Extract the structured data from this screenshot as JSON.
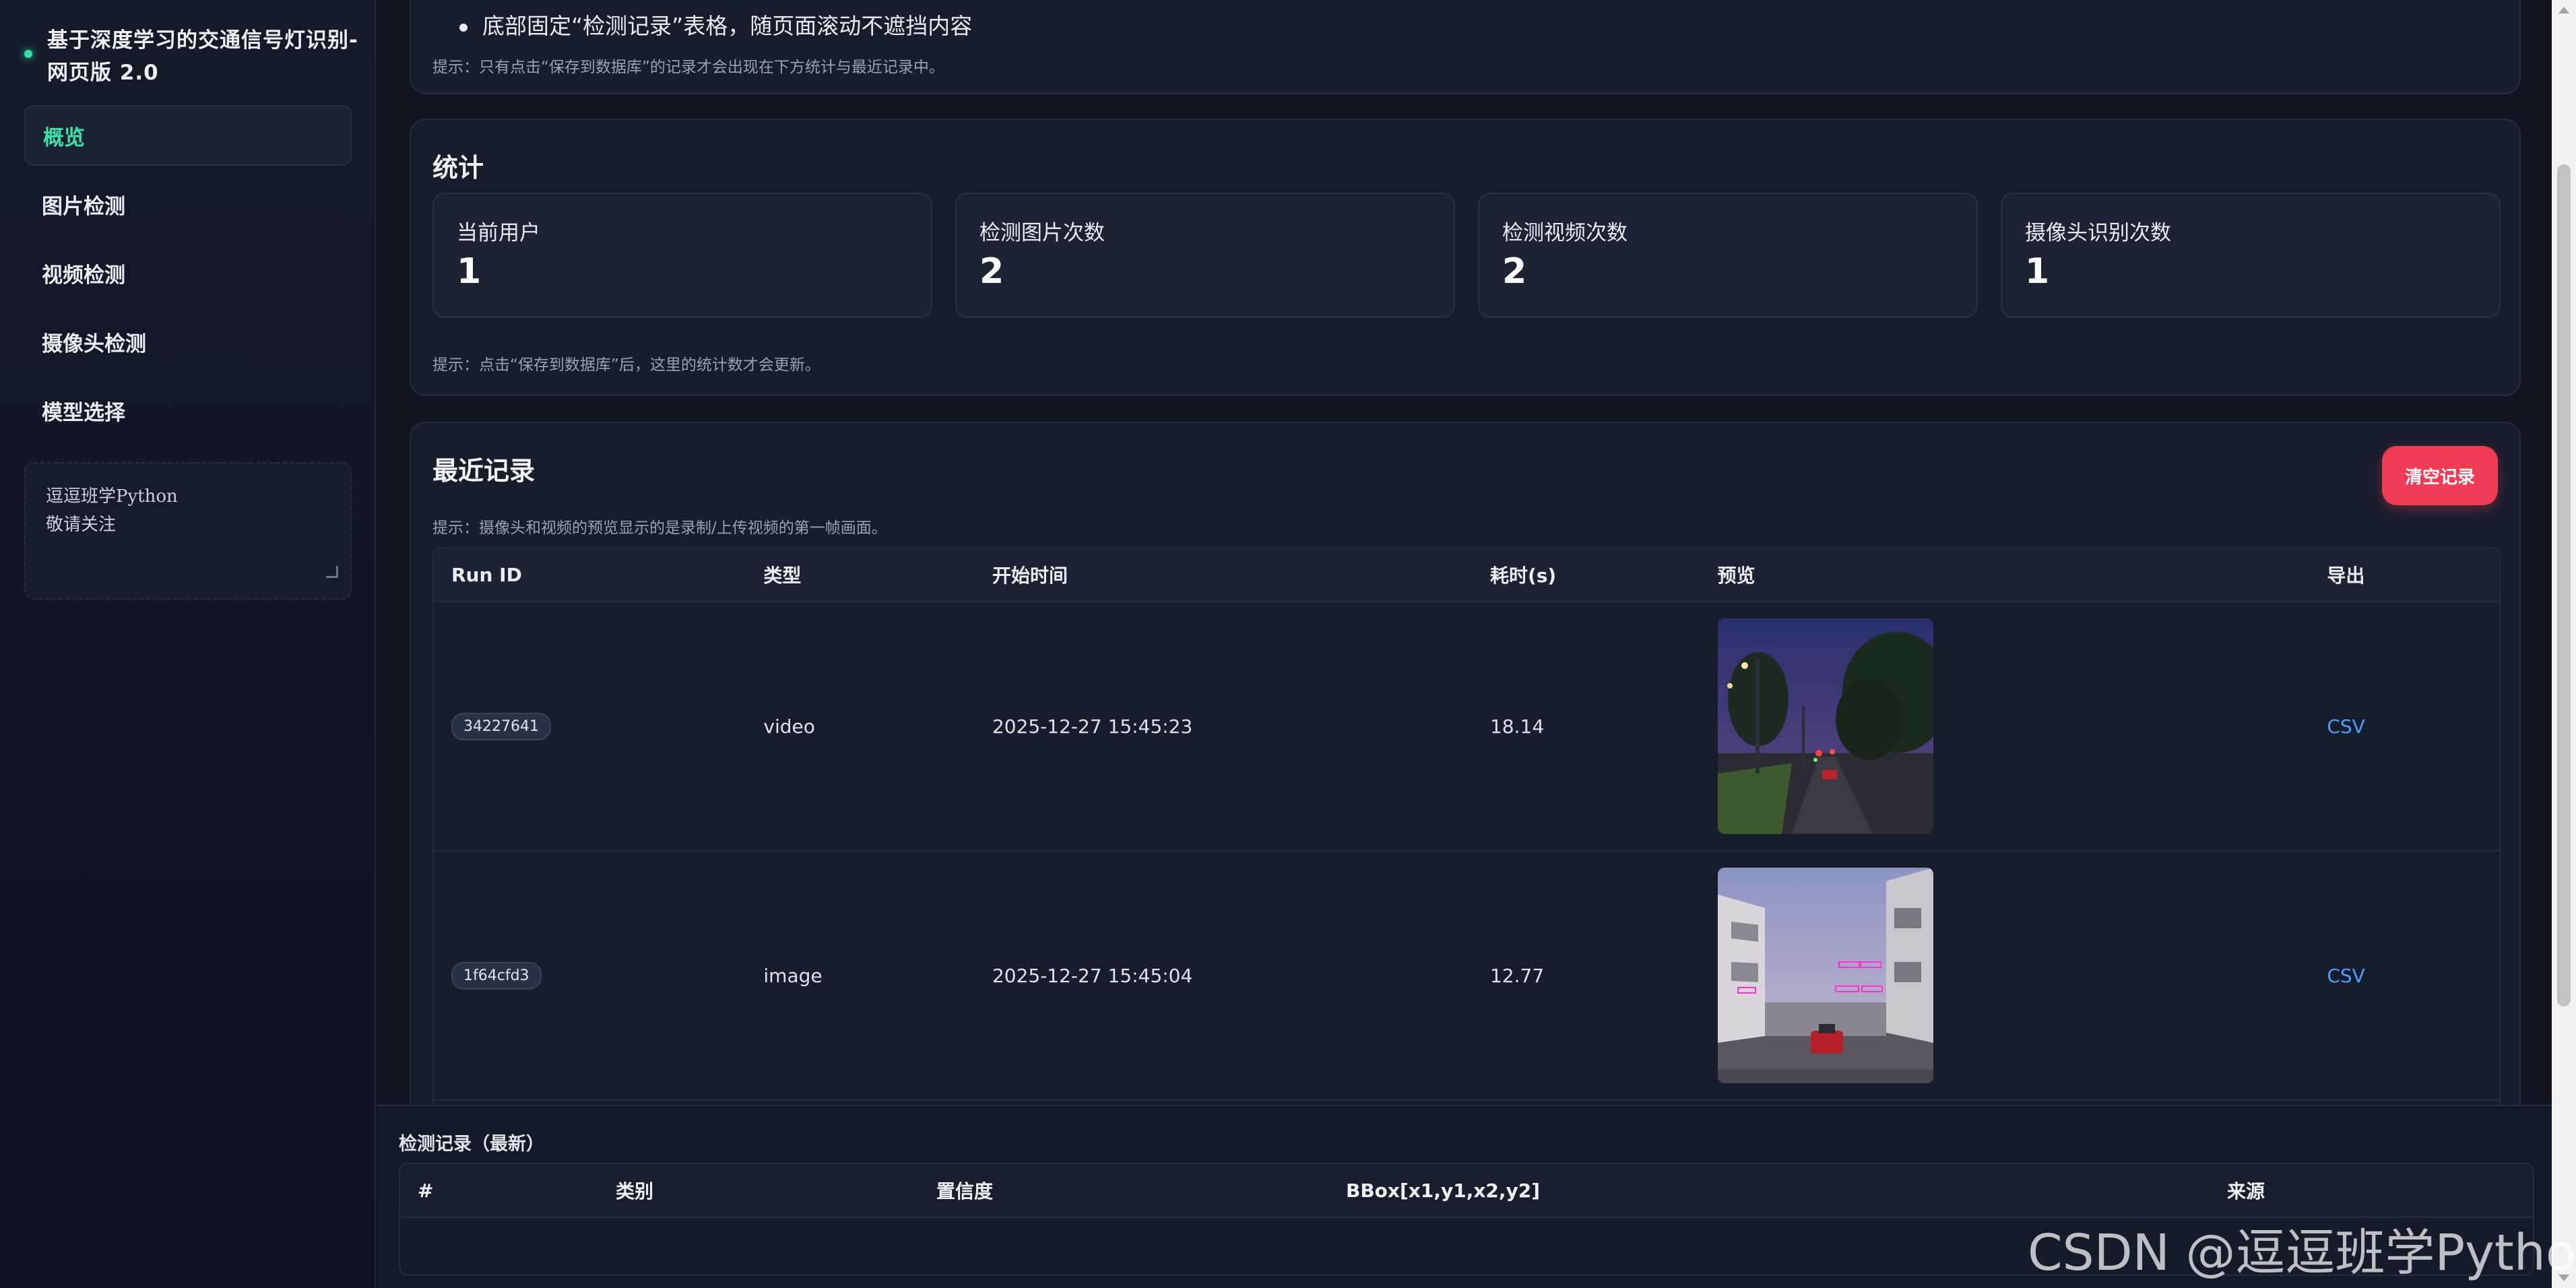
{
  "sidebar": {
    "brand_title": "基于深度学习的交通信号灯识别-网页版 2.0",
    "nav": [
      {
        "label": "概览",
        "active": true
      },
      {
        "label": "图片检测"
      },
      {
        "label": "视频检测"
      },
      {
        "label": "摄像头检测"
      },
      {
        "label": "模型选择"
      }
    ],
    "note": "逗逗班学Python\n敬请关注"
  },
  "top_card": {
    "bullet": "底部固定“检测记录”表格，随页面滚动不遮挡内容",
    "hint": "提示：只有点击“保存到数据库”的记录才会出现在下方统计与最近记录中。"
  },
  "stats": {
    "title": "统计",
    "items": [
      {
        "label": "当前用户",
        "value": "1"
      },
      {
        "label": "检测图片次数",
        "value": "2"
      },
      {
        "label": "检测视频次数",
        "value": "2"
      },
      {
        "label": "摄像头识别次数",
        "value": "1"
      }
    ],
    "hint": "提示：点击“保存到数据库”后，这里的统计数才会更新。"
  },
  "recent": {
    "title": "最近记录",
    "clear_label": "清空记录",
    "hint": "提示：摄像头和视频的预览显示的是录制/上传视频的第一帧画面。",
    "columns": [
      "Run ID",
      "类型",
      "开始时间",
      "耗时(s)",
      "预览",
      "导出"
    ],
    "rows": [
      {
        "run_id": "34227641",
        "type": "video",
        "start": "2025-12-27 15:45:23",
        "elapsed": "18.14",
        "export": "CSV"
      },
      {
        "run_id": "1f64cfd3",
        "type": "image",
        "start": "2025-12-27 15:45:04",
        "elapsed": "12.77",
        "export": "CSV"
      }
    ]
  },
  "bottom": {
    "title": "检测记录（最新）",
    "columns": [
      "#",
      "类别",
      "置信度",
      "BBox[x1,y1,x2,y2]",
      "来源"
    ]
  },
  "watermark": "CSDN @逗逗班学Python",
  "colors": {
    "accent": "#3fe0a8",
    "danger": "#ef3b53",
    "link": "#4d9cff",
    "background": "#101520"
  }
}
